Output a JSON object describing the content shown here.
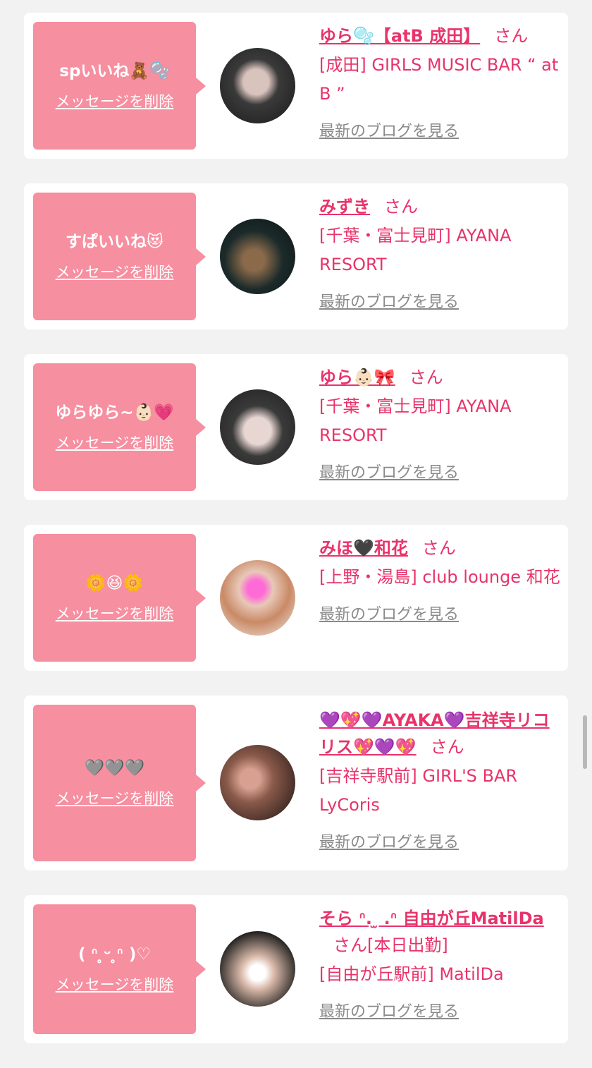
{
  "cards": [
    {
      "message": "spいいね🧸🫧",
      "delete_label": "メッセージを削除",
      "name": "ゆら🫧【atB 成田】",
      "honorific": "さん",
      "name_extra": "",
      "shop": "[成田] GIRLS MUSIC BAR “ at B ”",
      "blog_label": "最新のブログを見る",
      "avatar_colors": [
        "#3a3a3a",
        "#d9c3bd",
        "#1a1a1a"
      ]
    },
    {
      "message": "すぱいいね😻",
      "delete_label": "メッセージを削除",
      "name": "みずき",
      "honorific": "さん",
      "name_extra": "",
      "shop": "[千葉・富士見町] AYANA RESORT",
      "blog_label": "最新のブログを見る",
      "avatar_colors": [
        "#1b2a2a",
        "#7a6a3a",
        "#0e1415"
      ]
    },
    {
      "message": "ゆらゆら~👶🏻💗",
      "delete_label": "メッセージを削除",
      "name": "ゆら👶🏻🎀",
      "honorific": "さん",
      "name_extra": "",
      "shop": "[千葉・富士見町] AYANA RESORT",
      "blog_label": "最新のブログを見る",
      "avatar_colors": [
        "#2a2a2a",
        "#e8d6d2",
        "#f4f4f4"
      ]
    },
    {
      "message": "🌼😆🌼",
      "delete_label": "メッセージを削除",
      "name": "みほ🖤和花",
      "honorific": "さん",
      "name_extra": "",
      "shop": "[上野・湯島] club lounge 和花",
      "blog_label": "最新のブログを見る",
      "avatar_colors": [
        "#f2ece8",
        "#c98a66",
        "#ff6bd6"
      ]
    },
    {
      "message": "🩶🩶🩶",
      "delete_label": "メッセージを削除",
      "name": "💜💖💜AYAKA💜吉祥寺リコリス💖💜💖",
      "honorific": "さん",
      "name_extra": "",
      "shop": "[吉祥寺駅前] GIRL'S BAR LyCoris",
      "blog_label": "最新のブログを見る",
      "avatar_colors": [
        "#1a1212",
        "#8a5a4a",
        "#d8a090"
      ]
    },
    {
      "message": "(   ᐢ ̥ᵕ ̥ᐢ )♡",
      "delete_label": "メッセージを削除",
      "name": "そら ᐢ. ̫ .ᐢ 自由が丘MatilDa",
      "honorific": "さん",
      "name_extra": "[本日出勤]",
      "shop": "[自由が丘駅前] MatilDa",
      "blog_label": "最新のブログを見る",
      "avatar_colors": [
        "#1a1a1a",
        "#d8b8a8",
        "#ffffff"
      ]
    }
  ]
}
